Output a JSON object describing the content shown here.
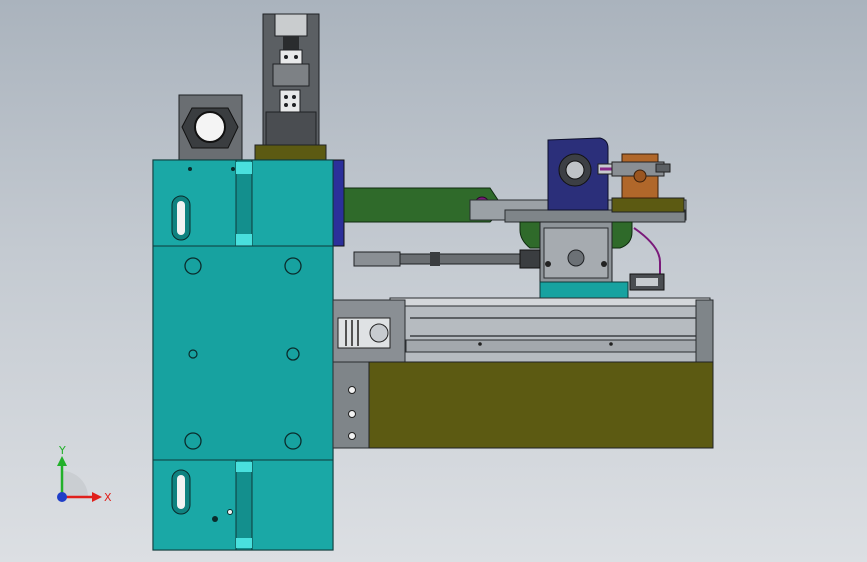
{
  "triad": {
    "x_label": "X",
    "y_label": "Y",
    "x_color": "#e0201c",
    "y_color": "#22b02a",
    "z_color": "#1f3ec8"
  },
  "colors": {
    "teal_plate": "#17a2a0",
    "olive_body": "#5c5a12",
    "green_arm": "#2f6a2a",
    "navy_motor": "#2b2f7a",
    "orange_block": "#b0672a",
    "rail_gray": "#9ba1a6",
    "dark_gray": "#3d4044"
  }
}
